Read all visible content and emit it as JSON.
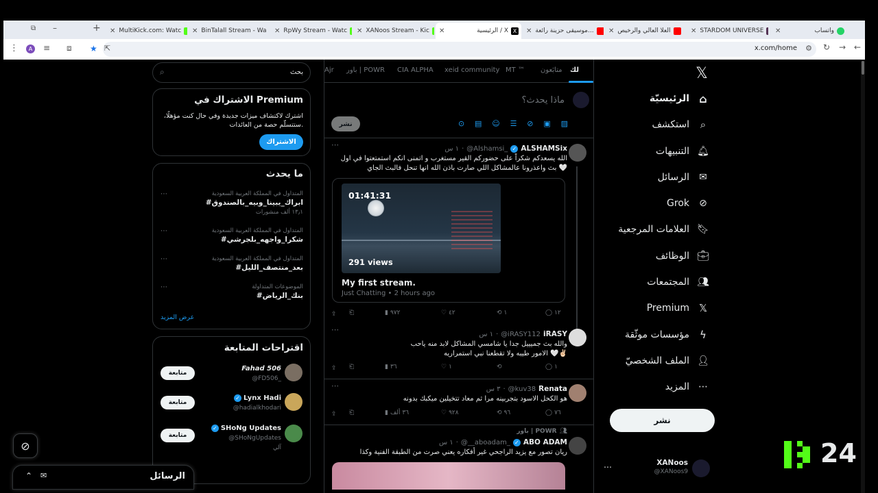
{
  "browser": {
    "tabs": [
      {
        "title": "MultiKick.com: Watc",
        "favicon": "kick"
      },
      {
        "title": "BinTalall Stream - Wa",
        "favicon": "kick"
      },
      {
        "title": "RpWy Stream - Watc",
        "favicon": "kick"
      },
      {
        "title": "XANoos Stream - Kic",
        "favicon": "kick"
      },
      {
        "title": "الرئيسية / X",
        "favicon": "x",
        "active": true
      },
      {
        "title": "موسيقى حزينة رائعة...",
        "favicon": "youtube"
      },
      {
        "title": "العلا العالي والرخيص",
        "favicon": "youtube"
      },
      {
        "title": "STARDOM UNIVERSE",
        "favicon": "stardom"
      },
      {
        "title": "واتساب",
        "favicon": "whatsapp"
      }
    ],
    "url": "x.com/home",
    "profile_initial": "A"
  },
  "sidebar": {
    "items": [
      {
        "label": "الرئيسيّة",
        "icon": "home-icon"
      },
      {
        "label": "استكشف",
        "icon": "search-icon"
      },
      {
        "label": "التنبيهات",
        "icon": "bell-icon"
      },
      {
        "label": "الرسائل",
        "icon": "mail-icon"
      },
      {
        "label": "Grok",
        "icon": "grok-icon"
      },
      {
        "label": "العلامات المرجعية",
        "icon": "bookmark-icon"
      },
      {
        "label": "الوظائف",
        "icon": "briefcase-icon"
      },
      {
        "label": "المجتمعات",
        "icon": "people-icon"
      },
      {
        "label": "Premium",
        "icon": "x-logo-icon"
      },
      {
        "label": "مؤسسات موثّقة",
        "icon": "lightning-icon"
      },
      {
        "label": "الملف الشخصيّ",
        "icon": "user-icon"
      },
      {
        "label": "المزيد",
        "icon": "more-circle-icon"
      }
    ],
    "post_button": "نشر",
    "account": {
      "name": "XANoos",
      "handle": "@XANoos9"
    }
  },
  "feed": {
    "tabs": [
      "لك",
      "متابَعون",
      "MT ™",
      "xeid community",
      "CIA ALPHA",
      "باور | POWR",
      "Ajr"
    ],
    "composer": {
      "placeholder": "ماذا يحدث؟",
      "post_button": "نشر"
    },
    "tweets": [
      {
        "name": "ALSHAMSix",
        "handle": "@Alshamsi_",
        "time": "١ س",
        "text": "الله يسعدكم شكراً على حضوركم القير مستغرب و اتمنى انكم استمتعتوا في اول بث واعذرونا عالمشاكل اللي صارت باذن الله انها تنحل فالبث الجاي 🤍",
        "embed": {
          "timer": "01:41:31",
          "views": "291 views",
          "title": "My first stream.",
          "subtitle": "Just Chatting • 2 hours ago"
        },
        "stats": {
          "replies": "١٢",
          "retweets": "١",
          "likes": "٤٢",
          "views": "٩٧٢"
        }
      },
      {
        "name": "iRASY",
        "handle": "@iRASY112",
        "time": "١ س",
        "text": "والله بث جميييل جدا يا شامسي المشاكل لابد منه ياحب الامور طيبه ولا تقطعنا نبي استمراريه 🤍✌🏻",
        "stats": {
          "replies": "١",
          "retweets": "",
          "likes": "١",
          "views": "٣٦"
        }
      },
      {
        "name": "Renata",
        "handle": "@kuv38",
        "time": "٣ س",
        "text": "هو الكحل الاسود بتجربينه مرا ثم معاد تتخيلين ميكبك بدونه",
        "stats": {
          "replies": "٧٦",
          "retweets": "٩٦",
          "likes": "٩٢٨",
          "views": "٣٦ ألف"
        }
      },
      {
        "community": "باور | POWR",
        "name": "ABO ADAM",
        "handle": "@__aboadam_",
        "time": "١ س",
        "text": "ريان تصور مع يزيد الراجحي غير أفكاره يعني صرت من الطبقة الفنية وكذا"
      }
    ]
  },
  "right": {
    "search_placeholder": "بحث",
    "premium": {
      "title": "الاشتراك في Premium",
      "body": "اشترك لاكتشاف ميزات جديدة وفي حال كنت مؤهلًا، ستتسلّم حصة من العائدات.",
      "button": "الاشتراك"
    },
    "trends": {
      "title": "ما يحدث",
      "items": [
        {
          "context": "المتداول في المملكة العربية السعودية",
          "tag": "#ابراك_يبينا_وبيه_بالصندوق",
          "count": "١٣٫١ ألف منشورات"
        },
        {
          "context": "المتداول في المملكة العربية السعودية",
          "tag": "#شكرا_واجهه_بلجرشي",
          "count": ""
        },
        {
          "context": "المتداول في المملكة العربية السعودية",
          "tag": "#بعد_منتصف_الليل",
          "count": ""
        },
        {
          "context": "الموضوعات المتداولة",
          "tag": "#بنك_الرياض",
          "count": ""
        }
      ],
      "show_more": "عرض المزيد"
    },
    "who_to_follow": {
      "title": "اقتراحات المتابعة",
      "button": "متابعة",
      "accounts": [
        {
          "name": "Fahad 506",
          "handle": "@FD506_",
          "verified": false,
          "sub": ""
        },
        {
          "name": "Lynx Hadi",
          "handle": "@hadialkhodari",
          "verified": true,
          "sub": ""
        },
        {
          "name": "SHoNg Updates",
          "handle": "@SHoNgUpdates",
          "verified": true,
          "sub": "آلي"
        }
      ]
    },
    "messages_bar": "الرسائل"
  },
  "overlay": {
    "number": "24"
  },
  "colors": {
    "accent": "#1d9bf0",
    "kick": "#53fc18",
    "bg": "#000000",
    "border": "#2f3336"
  }
}
